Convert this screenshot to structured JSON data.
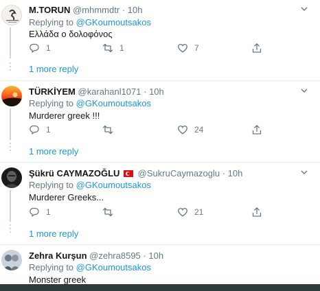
{
  "tweets": [
    {
      "name": "M.TORUN",
      "handle": "@mhmmdtr",
      "time": "10h",
      "replying_prefix": "Replying to",
      "replying_to": "@GKoumoutsakos",
      "text": "Ελλάδα ο δολοφόνος",
      "replies": "1",
      "retweets": "1",
      "likes": "7",
      "more_replies": "1 more reply"
    },
    {
      "name": "TÜRKİYEM",
      "handle": "@karahanl1071",
      "time": "10h",
      "replying_prefix": "Replying to",
      "replying_to": "@GKoumoutsakos",
      "text": "Murderer greek !!!",
      "replies": "1",
      "retweets": "",
      "likes": "24",
      "more_replies": "1 more reply"
    },
    {
      "name": "Şükrü CAYMAZOĞLU",
      "handle": "@SukruCaymazoglu",
      "time": "10h",
      "replying_prefix": "Replying to",
      "replying_to": "@GKoumoutsakos",
      "text": "Murderer Greeks...",
      "replies": "1",
      "retweets": "",
      "likes": "21",
      "more_replies": "1 more reply"
    },
    {
      "name": "Zehra Kurşun",
      "handle": "@zehra8595",
      "time": "10h",
      "replying_prefix": "Replying to",
      "replying_to": "@GKoumoutsakos",
      "text": "Monster greek"
    }
  ],
  "icons": {
    "reply": "reply-icon",
    "retweet": "retweet-icon",
    "like": "heart-icon",
    "share": "share-icon",
    "menu": "chevron-down-icon",
    "flag": "turkey-flag-icon"
  },
  "colors": {
    "link": "#1b95e0",
    "secondary_text": "#657786",
    "divider": "#e6ecf0"
  }
}
